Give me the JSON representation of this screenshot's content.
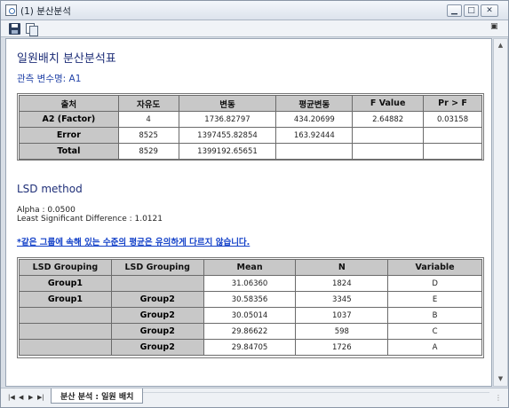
{
  "window": {
    "title": "(1) 분산분석"
  },
  "report": {
    "title": "일원배치 분산분석표",
    "variable_label": "관측 변수명: A1"
  },
  "anova": {
    "headers": [
      "출처",
      "자유도",
      "변동",
      "평균변동",
      "F Value",
      "Pr > F"
    ],
    "rows": [
      {
        "source": "A2 (Factor)",
        "df": "4",
        "ss": "1736.82797",
        "ms": "434.20699",
        "f": "2.64882",
        "p": "0.03158"
      },
      {
        "source": "Error",
        "df": "8525",
        "ss": "1397455.82854",
        "ms": "163.92444",
        "f": "",
        "p": ""
      },
      {
        "source": "Total",
        "df": "8529",
        "ss": "1399192.65651",
        "ms": "",
        "f": "",
        "p": ""
      }
    ]
  },
  "lsd": {
    "title": "LSD method",
    "alpha": "Alpha : 0.0500",
    "lsd_value": "Least Significant Difference : 1.0121",
    "note": "*같은 그룹에 속해 있는 수준의 평균은 유의하게 다르지 않습니다.",
    "headers": [
      "LSD Grouping",
      "LSD Grouping",
      "Mean",
      "N",
      "Variable"
    ],
    "rows": [
      {
        "g1": "Group1",
        "g2": "",
        "mean": "31.06360",
        "n": "1824",
        "var": "D"
      },
      {
        "g1": "Group1",
        "g2": "Group2",
        "mean": "30.58356",
        "n": "3345",
        "var": "E"
      },
      {
        "g1": "",
        "g2": "Group2",
        "mean": "30.05014",
        "n": "1037",
        "var": "B"
      },
      {
        "g1": "",
        "g2": "Group2",
        "mean": "29.86622",
        "n": "598",
        "var": "C"
      },
      {
        "g1": "",
        "g2": "Group2",
        "mean": "29.84705",
        "n": "1726",
        "var": "A"
      }
    ]
  },
  "footer": {
    "sheet_tab": "분산 분석 : 일원 배치"
  }
}
